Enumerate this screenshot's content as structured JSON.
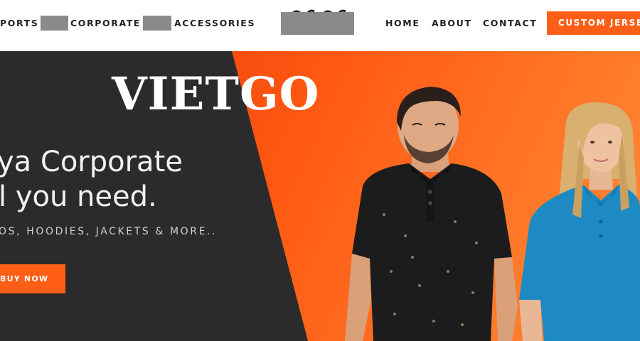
{
  "nav": {
    "left_items": [
      "PORTS",
      "CORPORATE",
      "ACCESSORIES"
    ],
    "right_items": [
      "HOME",
      "ABOUT",
      "CONTACT"
    ],
    "cta_label": "CUSTOM JERSEYS"
  },
  "hero": {
    "watermark": "VIETGO",
    "headline_line1": "ya Corporate",
    "headline_line2": "l you need.",
    "subtitle": "OS, HOODIES, JACKETS & MORE..",
    "button_label": "BUY NOW"
  },
  "colors": {
    "accent": "#ff5e17",
    "dark_panel": "#2b2b2b",
    "man_shirt": "#1c1c1c",
    "woman_shirt": "#1e8ac4",
    "redaction": "#8a8a8a"
  }
}
